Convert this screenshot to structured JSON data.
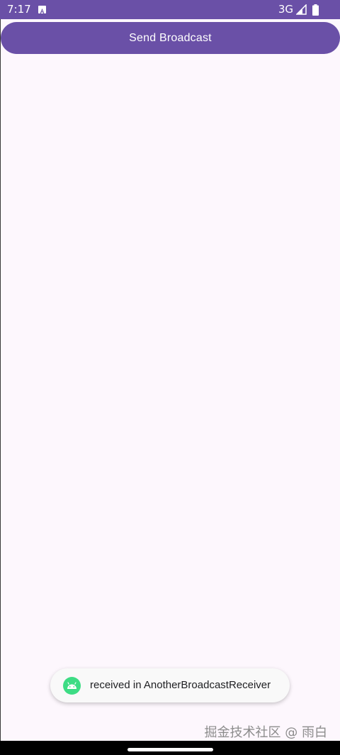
{
  "status_bar": {
    "time": "7:17",
    "network": "3G",
    "notification_icon": "android-auto-icon",
    "signal_icon": "signal-icon",
    "battery_icon": "battery-icon"
  },
  "main": {
    "send_button_label": "Send Broadcast"
  },
  "toast": {
    "icon": "android-icon",
    "message": "received in AnotherBroadcastReceiver"
  },
  "watermark": "掘金技术社区 @ 雨白",
  "colors": {
    "primary": "#6a50a7",
    "background": "#fdf7fd",
    "toast_icon": "#3ddc84"
  }
}
